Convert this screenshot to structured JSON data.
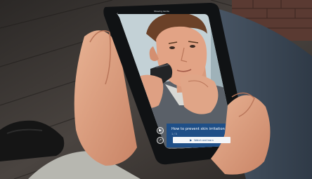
{
  "screen": {
    "status_title": "Shaving Guide",
    "back_glyph": "‹",
    "caption_title": "How to prevent skin irritation",
    "caption_step": "1 / 3",
    "cta_label": "Watch and learn",
    "cta_icon": "play-icon",
    "controls": [
      {
        "icon": "video-icon",
        "glyph": "▶"
      },
      {
        "icon": "share-icon",
        "glyph": "↗"
      }
    ]
  },
  "colors": {
    "floor": "#3b3632",
    "tablet": "#101214",
    "caption_bg": "#1f4f87",
    "skin": "#e2a385",
    "sweater": "#5a6068",
    "shirt": "#d8d8d4"
  }
}
